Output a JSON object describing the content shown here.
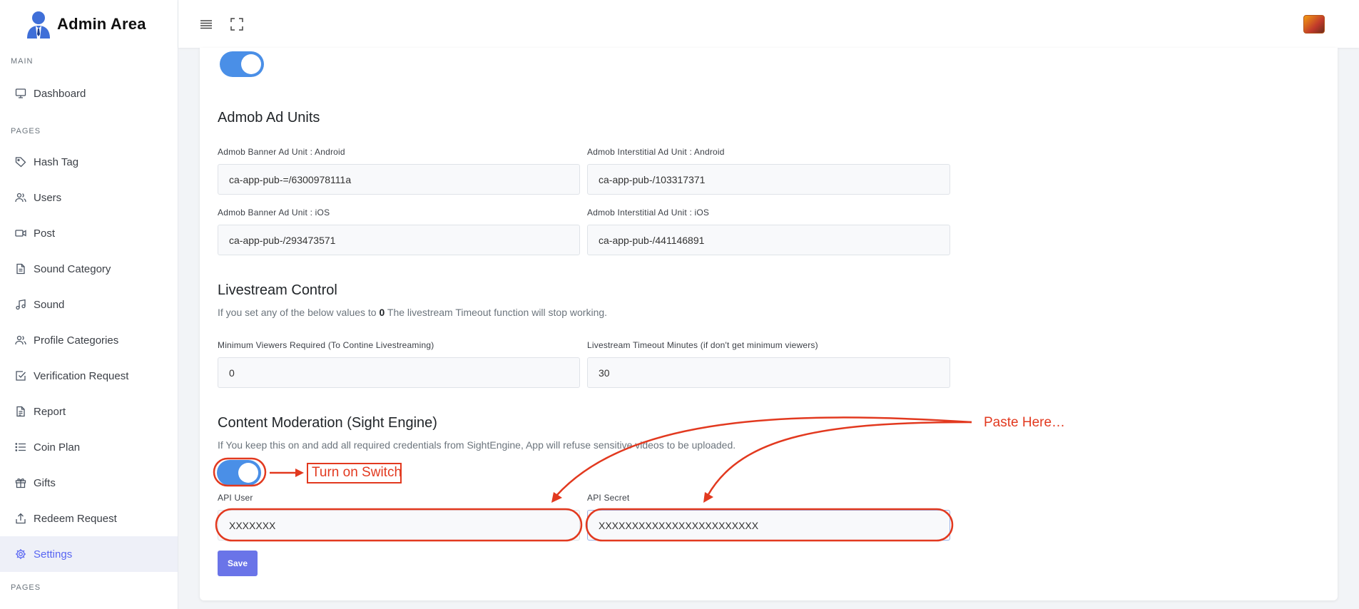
{
  "brand": {
    "title": "Admin Area"
  },
  "sidebar": {
    "sections": [
      "MAIN",
      "PAGES",
      "PAGES"
    ],
    "items": [
      {
        "label": "Dashboard",
        "icon": "monitor-icon"
      },
      {
        "label": "Hash Tag",
        "icon": "tag-icon"
      },
      {
        "label": "Users",
        "icon": "users-icon"
      },
      {
        "label": "Post",
        "icon": "video-icon"
      },
      {
        "label": "Sound Category",
        "icon": "file-icon"
      },
      {
        "label": "Sound",
        "icon": "music-icon"
      },
      {
        "label": "Profile Categories",
        "icon": "users-icon"
      },
      {
        "label": "Verification Request",
        "icon": "check-square-icon"
      },
      {
        "label": "Report",
        "icon": "file-text-icon"
      },
      {
        "label": "Coin Plan",
        "icon": "list-icon"
      },
      {
        "label": "Gifts",
        "icon": "gift-icon"
      },
      {
        "label": "Redeem Request",
        "icon": "upload-icon"
      },
      {
        "label": "Settings",
        "icon": "gear-icon",
        "active": true
      }
    ]
  },
  "admob": {
    "title": "Admob Ad Units",
    "banner_android_label": "Admob Banner Ad Unit : Android",
    "banner_android_value": "ca-app-pub-=/6300978111a",
    "interstitial_android_label": "Admob Interstitial Ad Unit : Android",
    "interstitial_android_value": "ca-app-pub-/103317371",
    "banner_ios_label": "Admob Banner Ad Unit : iOS",
    "banner_ios_value": "ca-app-pub-/293473571",
    "interstitial_ios_label": "Admob Interstitial Ad Unit : iOS",
    "interstitial_ios_value": "ca-app-pub-/441146891"
  },
  "livestream": {
    "title": "Livestream Control",
    "help_before": "If you set any of the below values to ",
    "help_bold": "0",
    "help_after": " The livestream Timeout function will stop working.",
    "min_viewers_label": "Minimum Viewers Required (To Contine Livestreaming)",
    "min_viewers_value": "0",
    "timeout_label": "Livestream Timeout Minutes (if don't get minimum viewers)",
    "timeout_value": "30"
  },
  "moderation": {
    "title": "Content Moderation (Sight Engine)",
    "help": "If You keep this on and add all required credentials from SightEngine, App will refuse sensitive videos to be uploaded.",
    "api_user_label": "API User",
    "api_user_value": "XXXXXXX",
    "api_secret_label": "API Secret",
    "api_secret_value": "XXXXXXXXXXXXXXXXXXXXXXXX"
  },
  "save_label": "Save",
  "annotations": {
    "turn_on": "Turn on Switch",
    "paste_here": "Paste Here…",
    "color": "#e2391f"
  },
  "colors": {
    "accent": "#5865f2",
    "toggle": "#4a8fe7",
    "button": "#6a74e8"
  }
}
